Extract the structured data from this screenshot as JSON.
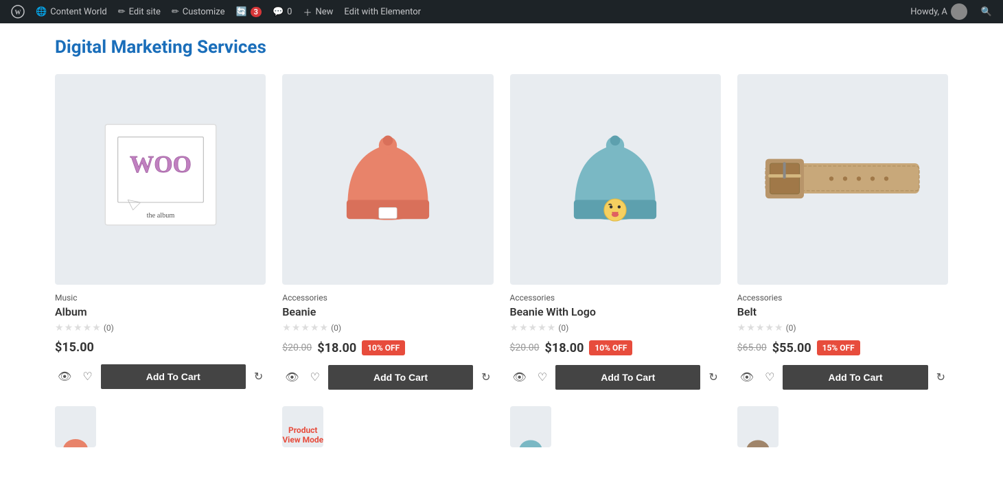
{
  "adminbar": {
    "site_name": "Content World",
    "edit_site": "Edit site",
    "customize": "Customize",
    "updates_count": "3",
    "comments_count": "0",
    "new_label": "New",
    "edit_elementor": "Edit with Elementor",
    "howdy": "Howdy, A"
  },
  "page": {
    "heading": "Digital Marketing Services"
  },
  "products": [
    {
      "category": "Music",
      "name": "Album",
      "rating": 0,
      "review_count": "(0)",
      "price_regular": "$15.00",
      "price_original": null,
      "price_sale": null,
      "discount": null,
      "add_to_cart_label": "Add To Cart",
      "image_type": "woo-album"
    },
    {
      "category": "Accessories",
      "name": "Beanie",
      "rating": 0,
      "review_count": "(0)",
      "price_original": "$20.00",
      "price_sale": "$18.00",
      "discount": "10% OFF",
      "add_to_cart_label": "Add To Cart",
      "image_type": "beanie-orange"
    },
    {
      "category": "Accessories",
      "name": "Beanie With Logo",
      "rating": 0,
      "review_count": "(0)",
      "price_original": "$20.00",
      "price_sale": "$18.00",
      "discount": "10% OFF",
      "add_to_cart_label": "Add To Cart",
      "image_type": "beanie-blue"
    },
    {
      "category": "Accessories",
      "name": "Belt",
      "rating": 0,
      "review_count": "(0)",
      "price_original": "$65.00",
      "price_sale": "$55.00",
      "discount": "15% OFF",
      "add_to_cart_label": "Add To Cart",
      "image_type": "belt"
    }
  ],
  "bottom_partial_label": "Product View Mode",
  "icons": {
    "eye": "👁",
    "heart": "♡",
    "refresh": "↻"
  }
}
